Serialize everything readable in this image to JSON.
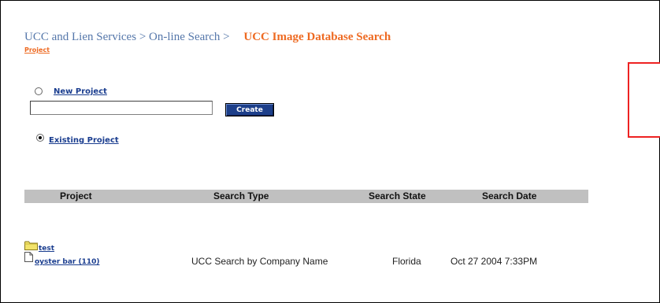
{
  "breadcrumb": {
    "part1": "UCC and Lien Services",
    "sep1": ">",
    "part2": "On-line Search",
    "sep2": ">",
    "current": "UCC Image Database Search"
  },
  "subtitle": "Project",
  "new_project": {
    "label": "New Project",
    "input_value": "",
    "create_label": "Create"
  },
  "existing_project": {
    "label": "Existing Project",
    "selected": true
  },
  "table": {
    "headers": [
      "Project",
      "Search Type",
      "Search State",
      "Search Date"
    ],
    "folder": {
      "name": "test",
      "icon": "folder-icon"
    },
    "rows": [
      {
        "project": "oyster bar (110)",
        "search_type": "UCC Search by Company Name",
        "search_state": "Florida",
        "search_date": "Oct 27 2004 7:33PM",
        "icon": "document-icon"
      }
    ]
  },
  "colors": {
    "breadcrumb": "#5577aa",
    "accent": "#ee6a22",
    "link": "#1a3d8f",
    "header_bg": "#c0c0c0",
    "button_bg": "#1d3f8a",
    "red_box": "#ee2222"
  }
}
